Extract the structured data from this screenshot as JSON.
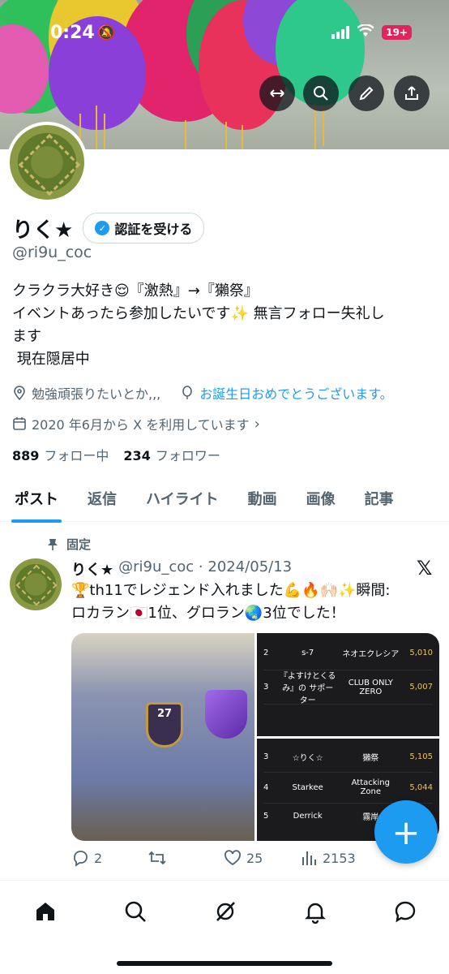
{
  "status_bar": {
    "time": "0:24",
    "battery": "19+"
  },
  "profile": {
    "display_name": "りく★",
    "verify_label": "認証を受ける",
    "handle": "@ri9u_coc",
    "bio_lines": [
      "クラクラ大好き😌『激熱』→『獺祭』",
      "イベントあったら参加したいです✨ 無言フォロー失礼し",
      "ます",
      " 現在隠居中"
    ],
    "location": "勉強頑張りたいとか,,,",
    "birthday": "お誕生日おめでとうございます。",
    "joined": "2020 年6月から X を利用しています",
    "following_count": "889",
    "following_label": "フォロー中",
    "followers_count": "234",
    "followers_label": "フォロワー"
  },
  "tabs": [
    "ポスト",
    "返信",
    "ハイライト",
    "動画",
    "画像",
    "記事"
  ],
  "tweet": {
    "pinned_label": "固定",
    "author": "りく★",
    "handle_date": "@ri9u_coc · 2024/05/13",
    "text_lines": [
      "🏆th11でレジェンド入れました💪🔥🙌🏻✨瞬間:",
      "ロカラン🇯🇵1位、グロラン🌏3位でした！"
    ],
    "media": {
      "trophy_level": "27",
      "rank_top": [
        {
          "pos": "2",
          "player": "s-7",
          "clan": "ネオエクレシア",
          "points": "5,010"
        },
        {
          "pos": "3",
          "player": "『よすけとくるみ』の サポーター",
          "clan": "CLUB ONLY ZERO",
          "points": "5,007"
        }
      ],
      "rank_bottom": [
        {
          "pos": "3",
          "player": "☆りく☆",
          "clan": "獺祭",
          "points": "5,105"
        },
        {
          "pos": "4",
          "player": "Starkee",
          "clan": "Attacking Zone",
          "points": "5,044"
        },
        {
          "pos": "5",
          "player": "Derrick",
          "clan": "霧岸",
          "points": ""
        }
      ]
    },
    "stats": {
      "replies": "2",
      "retweets": "",
      "likes": "25",
      "views": "2153"
    }
  },
  "colors": {
    "accent": "#1d9bf0",
    "text": "#0f1419",
    "muted": "#536471"
  },
  "icons": [
    "home-icon",
    "search-icon",
    "grok-icon",
    "notifications-icon",
    "messages-icon"
  ]
}
